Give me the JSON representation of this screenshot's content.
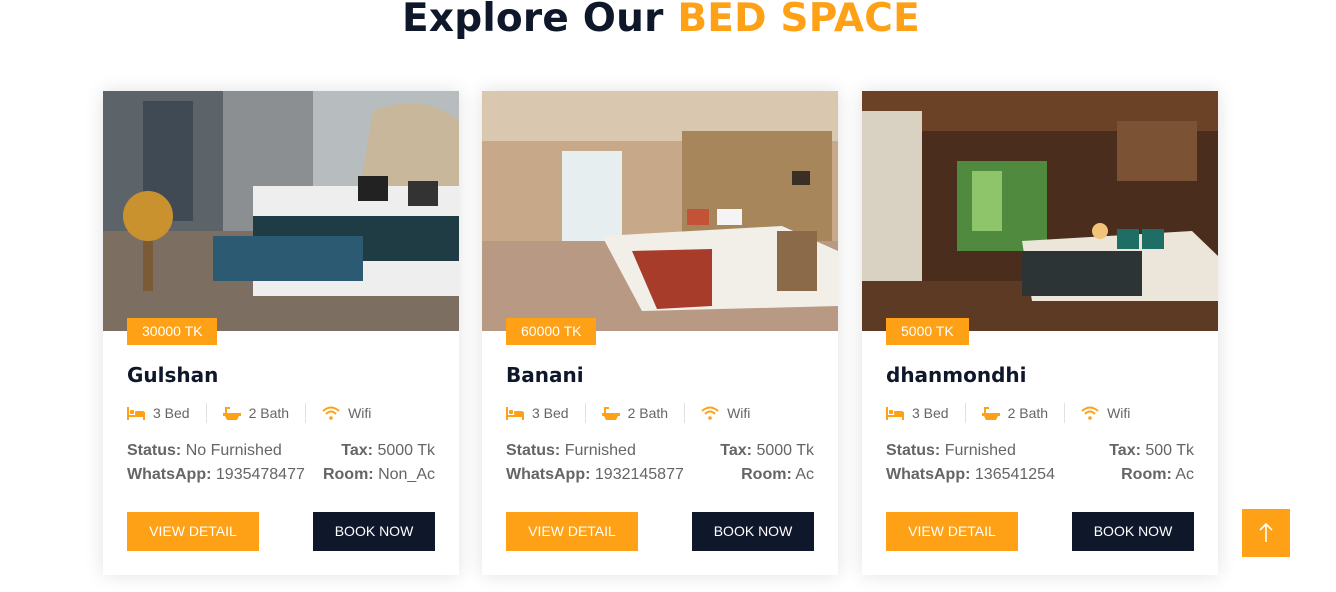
{
  "heading": {
    "prefix": "Explore Our",
    "accent": "BED SPACE"
  },
  "colors": {
    "accent": "#fea116",
    "dark": "#0f172b",
    "text": "#666565"
  },
  "features_icons": [
    "bed-icon",
    "bath-icon",
    "wifi-icon"
  ],
  "cards": [
    {
      "price": "30000 TK",
      "title": "Gulshan",
      "beds": "3 Bed",
      "baths": "2 Bath",
      "wifi": "Wifi",
      "status_label": "Status:",
      "status": "No Furnished",
      "tax_label": "Tax:",
      "tax": "5000 Tk",
      "whatsapp_label": "WhatsApp:",
      "whatsapp": "1935478477",
      "room_label": "Room:",
      "room": "Non_Ac",
      "detail_label": "VIEW DETAIL",
      "book_label": "BOOK NOW"
    },
    {
      "price": "60000 TK",
      "title": "Banani",
      "beds": "3 Bed",
      "baths": "2 Bath",
      "wifi": "Wifi",
      "status_label": "Status:",
      "status": "Furnished",
      "tax_label": "Tax:",
      "tax": "5000 Tk",
      "whatsapp_label": "WhatsApp:",
      "whatsapp": "1932145877",
      "room_label": "Room:",
      "room": "Ac",
      "detail_label": "VIEW DETAIL",
      "book_label": "BOOK NOW"
    },
    {
      "price": "5000 TK",
      "title": "dhanmondhi",
      "beds": "3 Bed",
      "baths": "2 Bath",
      "wifi": "Wifi",
      "status_label": "Status:",
      "status": "Furnished",
      "tax_label": "Tax:",
      "tax": "500 Tk",
      "whatsapp_label": "WhatsApp:",
      "whatsapp": "136541254",
      "room_label": "Room:",
      "room": "Ac",
      "detail_label": "VIEW DETAIL",
      "book_label": "BOOK NOW"
    }
  ]
}
